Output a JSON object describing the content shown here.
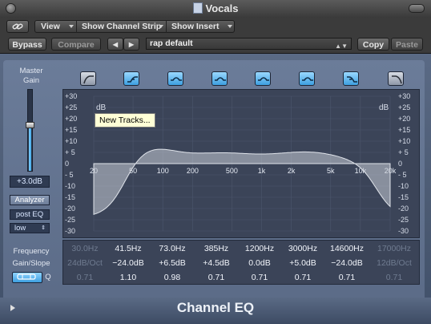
{
  "window": {
    "title": "Vocals"
  },
  "toolbar": {
    "link_icon": "link-icon",
    "view_label": "View",
    "channel_strip_label": "Show Channel Strip",
    "insert_label": "Show Insert",
    "bypass_label": "Bypass",
    "compare_label": "Compare",
    "prev_arrow": "◀",
    "next_arrow": "▶",
    "preset_name": "rap default",
    "copy_label": "Copy",
    "paste_label": "Paste"
  },
  "left_panel": {
    "master_gain_label": "Master Gain",
    "master_gain_value": "+3.0dB",
    "master_gain_db": 3.0,
    "analyzer_label": "Analyzer",
    "analyzer_mode": "post EQ",
    "analyzer_resolution": "low"
  },
  "graph": {
    "db_left_label": "dB",
    "db_right_label": "dB",
    "db_ticks": [
      "+30",
      "+25",
      "+20",
      "+15",
      "+10",
      "+ 5",
      "0",
      "- 5",
      "-10",
      "-15",
      "-20",
      "-25",
      "-30"
    ],
    "freq_ticks": [
      "20",
      "50",
      "100",
      "200",
      "500",
      "1k",
      "2k",
      "5k",
      "10k",
      "20k"
    ],
    "tooltip": "New Tracks..."
  },
  "bands": [
    {
      "type": "lowcut",
      "active": false,
      "frequency": "30.0Hz",
      "gain": "24dB/Oct",
      "q": "0.71"
    },
    {
      "type": "lowshelf",
      "active": true,
      "frequency": "41.5Hz",
      "gain": "−24.0dB",
      "q": "1.10"
    },
    {
      "type": "bell",
      "active": true,
      "frequency": "73.0Hz",
      "gain": "+6.5dB",
      "q": "0.98"
    },
    {
      "type": "bell",
      "active": true,
      "frequency": "385Hz",
      "gain": "+4.5dB",
      "q": "0.71"
    },
    {
      "type": "bell",
      "active": true,
      "frequency": "1200Hz",
      "gain": "0.0dB",
      "q": "0.71"
    },
    {
      "type": "bell",
      "active": true,
      "frequency": "3000Hz",
      "gain": "+5.0dB",
      "q": "0.71"
    },
    {
      "type": "highshelf",
      "active": true,
      "frequency": "14600Hz",
      "gain": "−24.0dB",
      "q": "0.71"
    },
    {
      "type": "highcut",
      "active": false,
      "frequency": "17000Hz",
      "gain": "12dB/Oct",
      "q": "0.71"
    }
  ],
  "param_labels": {
    "frequency": "Frequency",
    "gain_slope": "Gain/Slope",
    "q": "Q"
  },
  "footer": {
    "plugin_name": "Channel EQ"
  },
  "colors": {
    "accent": "#3d9fe0",
    "background": "#5a6a86",
    "graph": "#3b4458"
  }
}
